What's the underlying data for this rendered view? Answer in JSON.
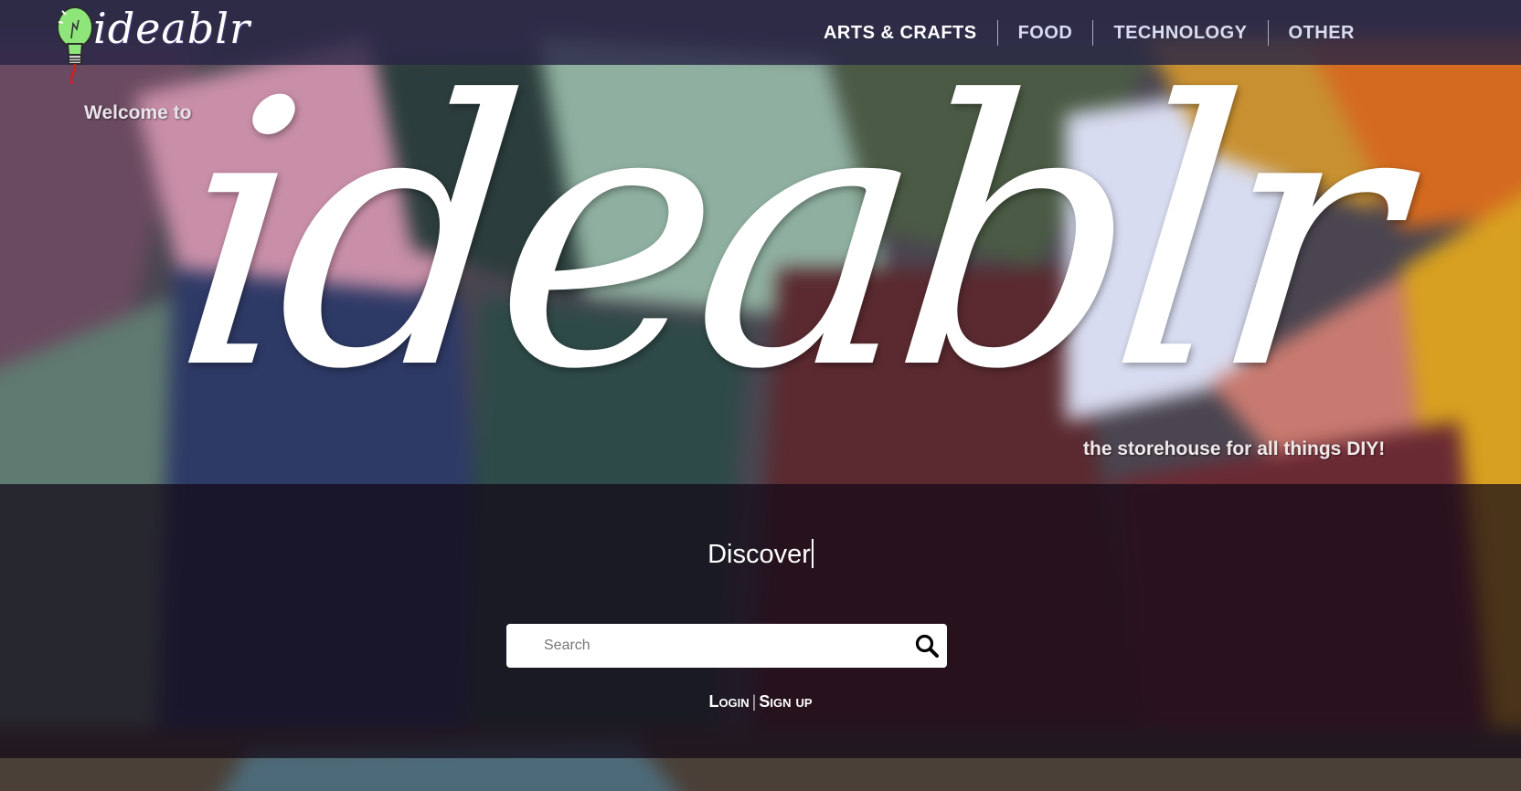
{
  "header": {
    "logo_text": "ideablr",
    "nav": [
      {
        "label": "Arts & Crafts"
      },
      {
        "label": "Food"
      },
      {
        "label": "Technology"
      },
      {
        "label": "Other"
      }
    ]
  },
  "hero": {
    "welcome": "Welcome to",
    "title": "ideablr",
    "tagline": "the storehouse for all things DIY!"
  },
  "search": {
    "heading": "Discover",
    "placeholder": "Search",
    "login_label": "Login",
    "signup_label": "Sign up",
    "separator": "|"
  },
  "icons": {
    "logo": "lightbulb-icon",
    "search": "magnifier-icon"
  },
  "colors": {
    "navbar": "#28264a",
    "band": "#12081a"
  }
}
